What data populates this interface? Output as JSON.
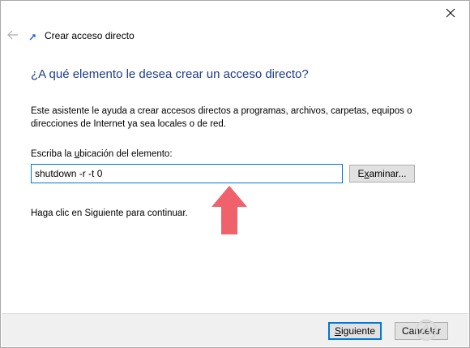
{
  "window": {
    "title": "Crear acceso directo"
  },
  "heading": "¿A qué elemento le desea crear un acceso directo?",
  "description": "Este asistente le ayuda a crear accesos directos a programas, archivos, carpetas, equipos o direcciones de Internet ya sea locales o de red.",
  "location": {
    "label_pre": "Escriba la ",
    "label_mnemonic": "u",
    "label_post": "bicación del elemento:",
    "value": "shutdown -r -t 0"
  },
  "browse": {
    "label_pre": "E",
    "label_mnemonic": "x",
    "label_post": "aminar..."
  },
  "hint": "Haga clic en Siguiente para continuar.",
  "footer": {
    "next_label_pre": "",
    "next_label_mnemonic": "S",
    "next_label_post": "iguiente",
    "cancel_label": "Cancelar"
  },
  "icons": {
    "close": "close-icon",
    "back": "back-arrow-icon",
    "wizard": "shortcut-wizard-icon",
    "annotation": "up-arrow-icon"
  },
  "colors": {
    "heading": "#1c3b8c",
    "focus": "#0078d7",
    "annotation_arrow": "#f0626b"
  }
}
